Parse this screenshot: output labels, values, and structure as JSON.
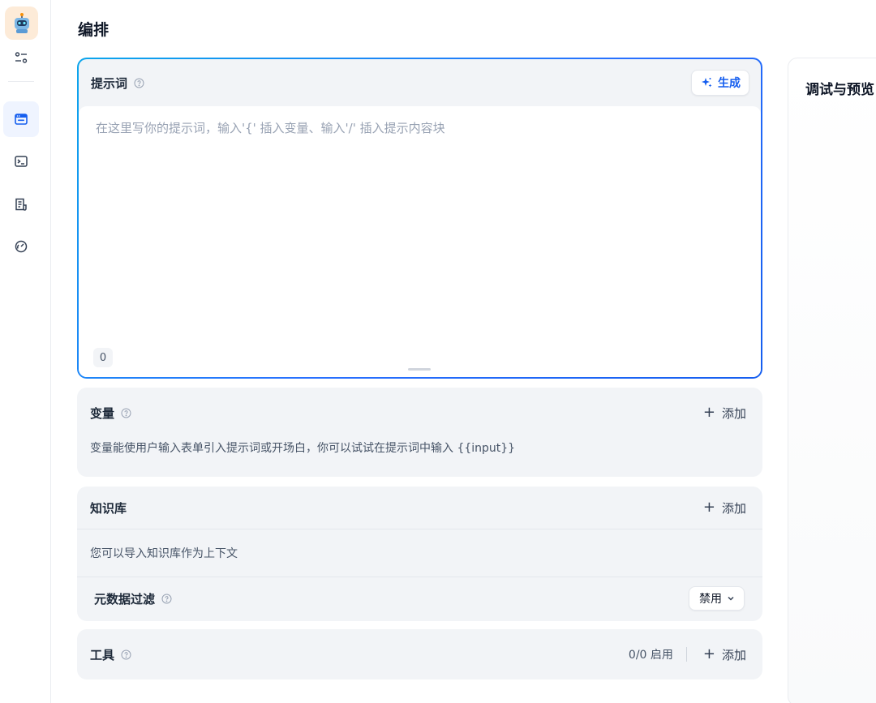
{
  "sidebar": {
    "items": [
      {
        "icon": "settings-sliders-icon"
      },
      {
        "icon": "orchestrate-icon",
        "active": true
      },
      {
        "icon": "terminal-icon"
      },
      {
        "icon": "logs-icon"
      },
      {
        "icon": "monitor-gauge-icon"
      }
    ]
  },
  "header": {
    "title": "编排"
  },
  "prompt": {
    "title": "提示词",
    "generate_label": "生成",
    "placeholder": "在这里写你的提示词，输入'{' 插入变量、输入'/' 插入提示内容块",
    "value": "",
    "char_count": "0"
  },
  "variables": {
    "title": "变量",
    "add_label": "添加",
    "description": "变量能使用户输入表单引入提示词或开场白，你可以试试在提示词中输入 {{input}}"
  },
  "knowledge": {
    "title": "知识库",
    "add_label": "添加",
    "description": "您可以导入知识库作为上下文",
    "metadata_filter": {
      "title": "元数据过滤",
      "selected": "禁用"
    }
  },
  "tools": {
    "title": "工具",
    "status": "0/0 启用",
    "add_label": "添加"
  },
  "debug": {
    "title": "调试与预览"
  },
  "colors": {
    "accent": "#155eef",
    "gradient_start": "#0ba5ec",
    "section_bg": "#f2f4f7"
  }
}
